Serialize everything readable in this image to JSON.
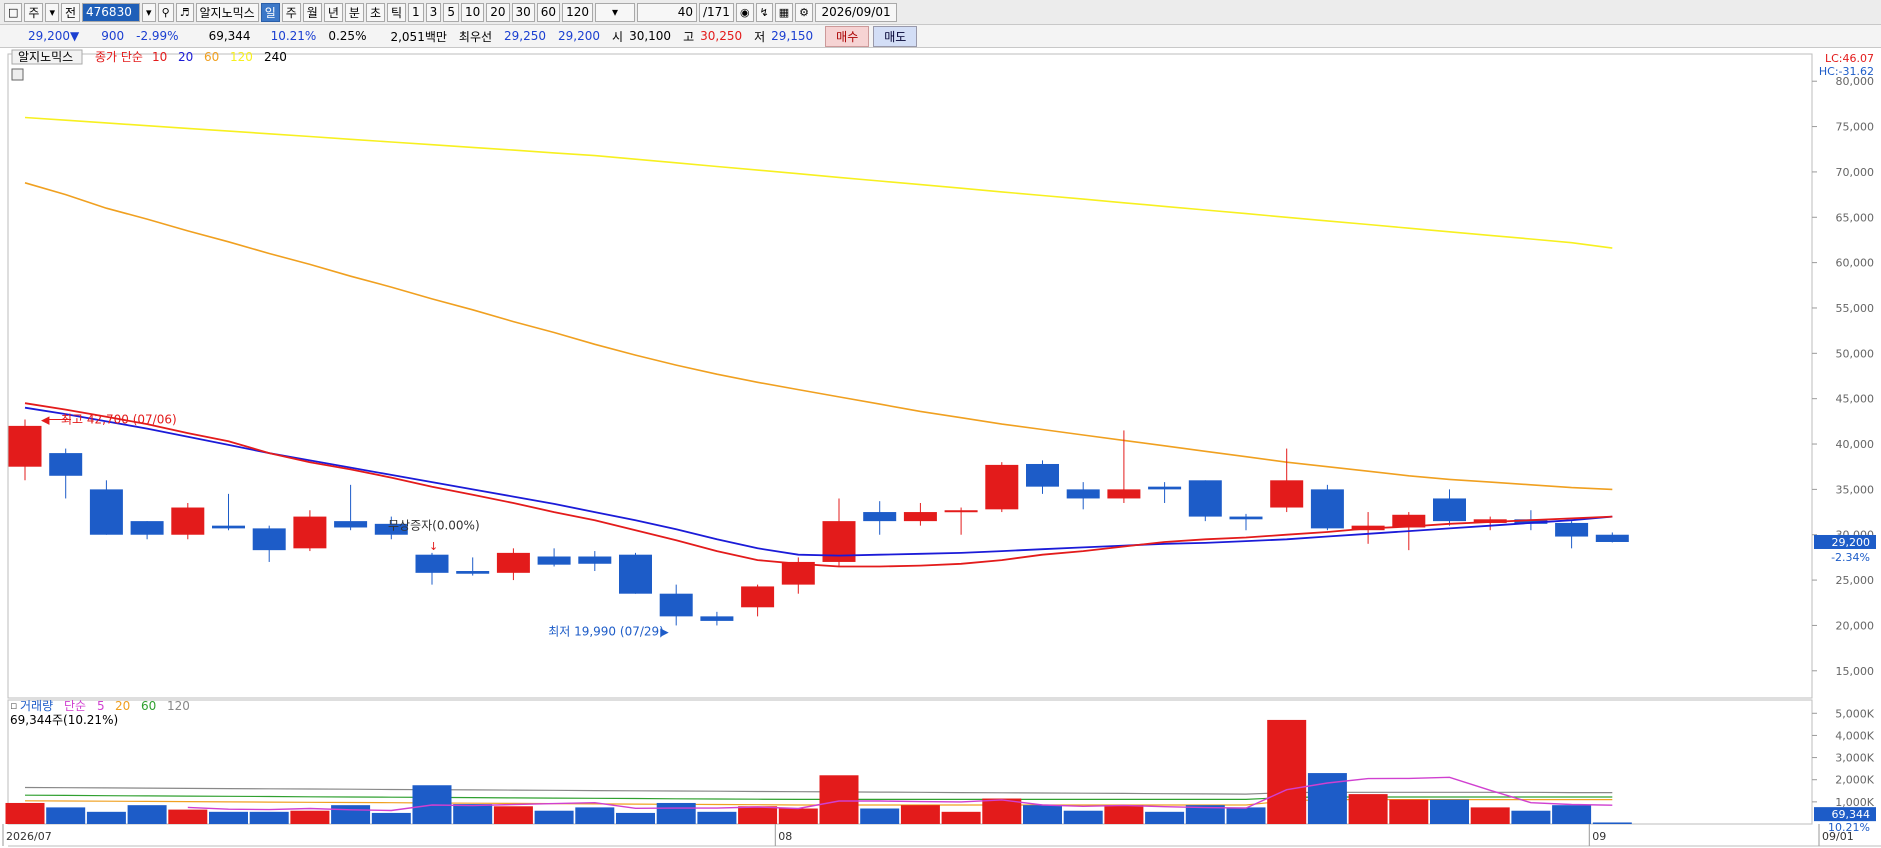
{
  "toolbar": {
    "market": "주",
    "mode": "전",
    "code": "476830",
    "name": "알지노믹스",
    "periods": [
      "일",
      "주",
      "월",
      "년",
      "분",
      "초",
      "틱"
    ],
    "active_period": "일",
    "intervals": [
      "1",
      "3",
      "5",
      "10",
      "20",
      "30",
      "60",
      "120"
    ],
    "count": "40",
    "total": "/171",
    "date": "2026/09/01"
  },
  "info": {
    "price": "29,200▼",
    "change": "900",
    "change_pct": "-2.99%",
    "volume": "69,344",
    "vol_pct": "10.21%",
    "turnover": "0.25%",
    "amount": "2,051백만",
    "bid_label": "최우선",
    "bid1": "29,250",
    "bid2": "29,200",
    "open_label": "시",
    "open": "30,100",
    "high_label": "고",
    "high": "30,250",
    "low_label": "저",
    "low": "29,150",
    "buy": "매수",
    "sell": "매도"
  },
  "colors": {
    "up": "#e31b1b",
    "down": "#1d5cc8",
    "ma5": "#e31b1b",
    "ma10": "#1b1bd8",
    "ma20": "#f0a020",
    "ma60": "#f7f020",
    "vma5": "#d040d0",
    "vma20": "#f0a020",
    "vma60": "#30a030",
    "vma120": "#888888"
  },
  "chart_data": [
    {
      "type": "candlestick",
      "title": "알지노믹스",
      "legend": {
        "label": "종가 단순",
        "periods": [
          {
            "name": "10",
            "color": "#e31b1b"
          },
          {
            "name": "20",
            "color": "#1b1bd8"
          },
          {
            "name": "60",
            "color": "#f0a020"
          },
          {
            "name": "120",
            "color": "#f7f020"
          },
          {
            "name": "240",
            "color": "#000000"
          }
        ]
      },
      "corner_labels": [
        "LC:46.07",
        "HC:-31.62"
      ],
      "y_ticks": [
        "80,000",
        "75,000",
        "70,000",
        "65,000",
        "60,000",
        "55,000",
        "50,000",
        "45,000",
        "40,000",
        "35,000",
        "30,000",
        "25,000",
        "20,000",
        "15,000"
      ],
      "ylim": [
        12000,
        83000
      ],
      "current_price": "29,200",
      "current_change": "-2.34%",
      "annotations": {
        "high": "최고 42,700 (07/06)",
        "low": "최저 19,990 (07/29)",
        "event": "무상증자(0.00%)"
      },
      "candles": [
        {
          "o": 37500,
          "h": 42700,
          "l": 36000,
          "c": 42000
        },
        {
          "o": 39000,
          "h": 39500,
          "l": 34000,
          "c": 36500
        },
        {
          "o": 35000,
          "h": 36000,
          "l": 30000,
          "c": 30000
        },
        {
          "o": 31500,
          "h": 31500,
          "l": 29500,
          "c": 30000
        },
        {
          "o": 30000,
          "h": 33500,
          "l": 29500,
          "c": 33000
        },
        {
          "o": 31000,
          "h": 34500,
          "l": 30500,
          "c": 30700
        },
        {
          "o": 30700,
          "h": 31000,
          "l": 27000,
          "c": 28300
        },
        {
          "o": 28500,
          "h": 32700,
          "l": 28200,
          "c": 32000
        },
        {
          "o": 31500,
          "h": 35500,
          "l": 30500,
          "c": 30800
        },
        {
          "o": 31200,
          "h": 32000,
          "l": 29500,
          "c": 30000
        },
        {
          "o": 27800,
          "h": 28000,
          "l": 24500,
          "c": 25800
        },
        {
          "o": 26000,
          "h": 27500,
          "l": 25500,
          "c": 25700
        },
        {
          "o": 25800,
          "h": 28500,
          "l": 25000,
          "c": 28000
        },
        {
          "o": 27600,
          "h": 28500,
          "l": 26500,
          "c": 26700
        },
        {
          "o": 27600,
          "h": 28200,
          "l": 26000,
          "c": 26800
        },
        {
          "o": 27800,
          "h": 28000,
          "l": 23500,
          "c": 23500
        },
        {
          "o": 23500,
          "h": 24500,
          "l": 20000,
          "c": 21000
        },
        {
          "o": 21000,
          "h": 21500,
          "l": 20000,
          "c": 20500
        },
        {
          "o": 22000,
          "h": 24500,
          "l": 21000,
          "c": 24300
        },
        {
          "o": 24500,
          "h": 27500,
          "l": 23500,
          "c": 27000
        },
        {
          "o": 27000,
          "h": 34000,
          "l": 26500,
          "c": 31500
        },
        {
          "o": 32500,
          "h": 33700,
          "l": 30000,
          "c": 31500
        },
        {
          "o": 31500,
          "h": 33500,
          "l": 31000,
          "c": 32500
        },
        {
          "o": 32500,
          "h": 33000,
          "l": 30000,
          "c": 32700
        },
        {
          "o": 32800,
          "h": 38000,
          "l": 32500,
          "c": 37700
        },
        {
          "o": 37800,
          "h": 38200,
          "l": 34500,
          "c": 35300
        },
        {
          "o": 35000,
          "h": 35800,
          "l": 32800,
          "c": 34000
        },
        {
          "o": 34000,
          "h": 41500,
          "l": 33500,
          "c": 35000
        },
        {
          "o": 35300,
          "h": 35800,
          "l": 33500,
          "c": 35000
        },
        {
          "o": 36000,
          "h": 36000,
          "l": 31500,
          "c": 32000
        },
        {
          "o": 32000,
          "h": 32300,
          "l": 30500,
          "c": 31700
        },
        {
          "o": 33000,
          "h": 39500,
          "l": 32500,
          "c": 36000
        },
        {
          "o": 35000,
          "h": 35500,
          "l": 30500,
          "c": 30700
        },
        {
          "o": 30500,
          "h": 32500,
          "l": 29000,
          "c": 31000
        },
        {
          "o": 30800,
          "h": 32500,
          "l": 28300,
          "c": 32200
        },
        {
          "o": 34000,
          "h": 35000,
          "l": 31000,
          "c": 31500
        },
        {
          "o": 31300,
          "h": 32000,
          "l": 30500,
          "c": 31700
        },
        {
          "o": 31700,
          "h": 32700,
          "l": 30500,
          "c": 31200
        },
        {
          "o": 31300,
          "h": 31500,
          "l": 28500,
          "c": 29800
        },
        {
          "o": 30000,
          "h": 30250,
          "l": 29150,
          "c": 29200
        }
      ],
      "ma10": [
        44500,
        43800,
        43000,
        42200,
        41200,
        40300,
        39000,
        38000,
        37200,
        36300,
        35300,
        34400,
        33500,
        32500,
        31600,
        30500,
        29400,
        28200,
        27200,
        26800,
        26500,
        26500,
        26600,
        26800,
        27200,
        27800,
        28200,
        28700,
        29200,
        29500,
        29700,
        30000,
        30300,
        30700,
        30900,
        31200,
        31400,
        31600,
        31800,
        32000
      ],
      "ma20": [
        44000,
        43300,
        42500,
        41700,
        40800,
        39900,
        39000,
        38200,
        37400,
        36600,
        35800,
        35000,
        34200,
        33400,
        32500,
        31600,
        30600,
        29500,
        28500,
        27800,
        27700,
        27800,
        27900,
        28000,
        28200,
        28400,
        28600,
        28800,
        29000,
        29100,
        29300,
        29500,
        29800,
        30100,
        30400,
        30700,
        31000,
        31300,
        31600,
        32000
      ],
      "ma60": [
        68800,
        67500,
        66000,
        64800,
        63500,
        62300,
        61000,
        59800,
        58500,
        57300,
        56000,
        54800,
        53500,
        52300,
        51000,
        49800,
        48700,
        47700,
        46800,
        46000,
        45200,
        44400,
        43600,
        42900,
        42200,
        41600,
        41000,
        40400,
        39800,
        39200,
        38600,
        38000,
        37500,
        37000,
        36500,
        36100,
        35800,
        35500,
        35200,
        35000
      ],
      "ma120": [
        76000,
        75700,
        75400,
        75100,
        74800,
        74500,
        74200,
        73900,
        73600,
        73300,
        73000,
        72700,
        72400,
        72100,
        71800,
        71400,
        71000,
        70600,
        70200,
        69800,
        69400,
        69000,
        68600,
        68200,
        67800,
        67400,
        67000,
        66600,
        66200,
        65800,
        65400,
        65000,
        64600,
        64200,
        63800,
        63400,
        63000,
        62600,
        62200,
        61600
      ],
      "x_labels": [
        {
          "index": 0,
          "text": "2026/07"
        },
        {
          "index": 19,
          "text": "08"
        },
        {
          "index": 39,
          "text": "09"
        },
        {
          "index": 45,
          "text": "09/01"
        }
      ]
    },
    {
      "type": "bar",
      "title": "거래량",
      "legend": {
        "label": "단순",
        "periods": [
          {
            "name": "5",
            "color": "#d040d0"
          },
          {
            "name": "20",
            "color": "#f0a020"
          },
          {
            "name": "60",
            "color": "#30a030"
          },
          {
            "name": "120",
            "color": "#888888"
          }
        ]
      },
      "summary": "69,344주(10.21%)",
      "y_ticks": [
        "5,000K",
        "4,000K",
        "3,000K",
        "2,000K",
        "1,000K"
      ],
      "ylim": [
        0,
        5600000
      ],
      "current_volume": "69,344",
      "current_pct": "10.21%",
      "values": [
        950000,
        750000,
        550000,
        850000,
        650000,
        550000,
        550000,
        600000,
        850000,
        500000,
        1750000,
        900000,
        800000,
        600000,
        750000,
        500000,
        950000,
        550000,
        800000,
        700000,
        2200000,
        700000,
        850000,
        550000,
        1150000,
        850000,
        600000,
        850000,
        550000,
        850000,
        750000,
        4700000,
        2300000,
        1350000,
        1100000,
        1100000,
        750000,
        600000,
        850000,
        69344
      ],
      "ma5": [
        null,
        null,
        null,
        null,
        750000,
        670000,
        650000,
        700000,
        640000,
        610000,
        860000,
        830000,
        880000,
        920000,
        960000,
        710000,
        720000,
        720000,
        770000,
        700000,
        1040000,
        1040000,
        1010000,
        1000000,
        1090000,
        860000,
        800000,
        840000,
        780000,
        740000,
        720000,
        1550000,
        1850000,
        2050000,
        2060000,
        2110000,
        1520000,
        960000,
        880000,
        850000
      ],
      "ma20": [
        1050000,
        1040000,
        1030000,
        1020000,
        1010000,
        1000000,
        990000,
        980000,
        970000,
        960000,
        950000,
        940000,
        930000,
        920000,
        910000,
        900000,
        890000,
        880000,
        870000,
        860000,
        860000,
        860000,
        860000,
        860000,
        860000,
        860000,
        860000,
        860000,
        860000,
        860000,
        860000,
        1050000,
        1100000,
        1100000,
        1100000,
        1100000,
        1100000,
        1100000,
        1100000,
        1100000
      ],
      "ma60": [
        1300000,
        1290000,
        1280000,
        1270000,
        1260000,
        1250000,
        1240000,
        1230000,
        1220000,
        1210000,
        1200000,
        1190000,
        1180000,
        1170000,
        1160000,
        1150000,
        1140000,
        1130000,
        1120000,
        1110000,
        1110000,
        1110000,
        1110000,
        1110000,
        1110000,
        1110000,
        1110000,
        1110000,
        1110000,
        1110000,
        1110000,
        1200000,
        1220000,
        1220000,
        1220000,
        1220000,
        1220000,
        1220000,
        1220000,
        1220000
      ],
      "ma120": [
        1650000,
        1640000,
        1630000,
        1620000,
        1610000,
        1600000,
        1590000,
        1580000,
        1570000,
        1560000,
        1550000,
        1540000,
        1530000,
        1520000,
        1510000,
        1500000,
        1490000,
        1480000,
        1470000,
        1460000,
        1450000,
        1440000,
        1430000,
        1420000,
        1410000,
        1400000,
        1390000,
        1380000,
        1370000,
        1360000,
        1350000,
        1420000,
        1430000,
        1430000,
        1430000,
        1430000,
        1430000,
        1430000,
        1420000,
        1420000
      ]
    }
  ]
}
